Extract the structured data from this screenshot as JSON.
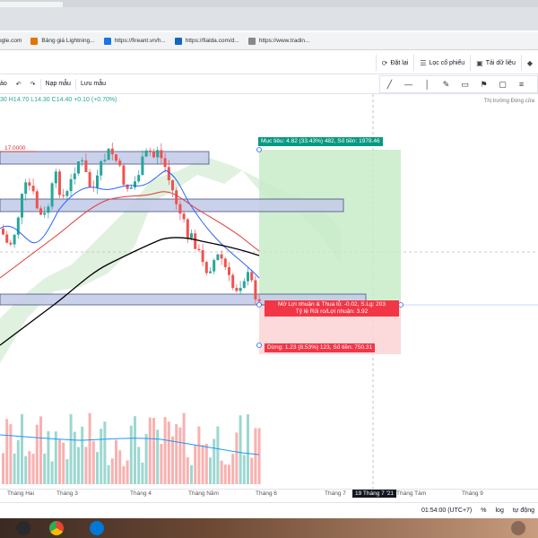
{
  "bookmarks": [
    {
      "label": "ogle.com",
      "icon": "google-icon",
      "color": "#4285f4"
    },
    {
      "label": "Bảng giá Lightning...",
      "icon": "lightning-board-icon",
      "color": "#e37400"
    },
    {
      "label": "https://fireant.vn/h...",
      "icon": "fireant-icon",
      "color": "#1a73e8"
    },
    {
      "label": "https://fialda.com/d...",
      "icon": "fialda-icon",
      "color": "#1565c0"
    },
    {
      "label": "https://www.tradin...",
      "icon": "globe-icon",
      "color": "#888888"
    }
  ],
  "toolbar": {
    "reset_label": "Đặt lại",
    "filter_label": "Lọc cổ phiếu",
    "download_label": "Tải dữ liệu",
    "load_template_label": "Nạp mẫu",
    "save_template_label": "Lưu mẫu",
    "left_cut_label": "ảo"
  },
  "ohlc": {
    "open": "30",
    "high": "H14.70",
    "low": "L14.30",
    "close": "C14.40",
    "change": "+0.10 (+0.70%)"
  },
  "market_status": "Thị trường Đóng cửa",
  "levels": {
    "horizontal_level": "17.0000"
  },
  "position": {
    "target": "Mục tiêu: 4.82 (33.43%) 482, Số tiền: 1978.46",
    "open_pl": "Mở Lợi nhuận & Thua lỗ: -0.02, S.Lg: 203",
    "rr": "Tỷ lệ Rủi ro/Lợi nhuận: 3.92",
    "stop": "Dừng: 1.23 (8.53%) 123, Số tiền: 750.31"
  },
  "xaxis": {
    "ticks": [
      "Tháng Hai",
      "Tháng 3",
      "Tháng 4",
      "Tháng Năm",
      "Tháng 6",
      "Tháng 7",
      "Tháng Tám",
      "Tháng 9"
    ],
    "cursor_label": "19 Tháng 7 '21"
  },
  "bottom": {
    "time": "01:54:00 (UTC+7)",
    "percent": "%",
    "log": "log",
    "auto": "tự động"
  },
  "colors": {
    "up": "#26a69a",
    "down": "#ef5350",
    "zone_fill": "#c5cde8",
    "zone_stroke": "#1e2a6e",
    "profit_zone": "#c8ecc8",
    "loss_zone": "#fbd4d6",
    "ma_blue": "#2962ff",
    "ma_red": "#e53935",
    "ma_black": "#000000",
    "volume_ma": "#2196f3"
  }
}
